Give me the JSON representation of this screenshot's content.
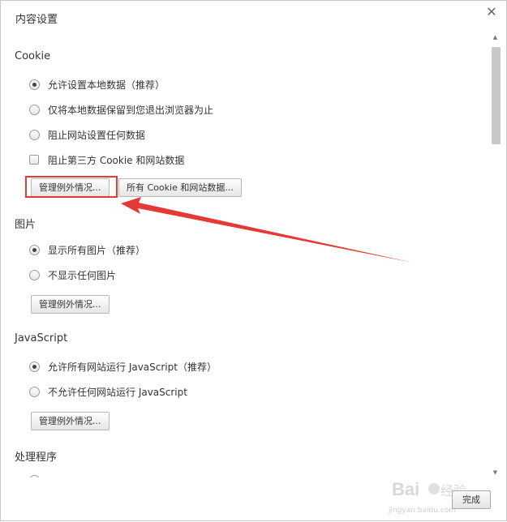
{
  "dialog": {
    "title": "内容设置",
    "done_label": "完成"
  },
  "cookie": {
    "section_title": "Cookie",
    "options": [
      "允许设置本地数据（推荐）",
      "仅将本地数据保留到您退出浏览器为止",
      "阻止网站设置任何数据"
    ],
    "selected_index": 0,
    "block_third_party_label": "阻止第三方 Cookie 和网站数据",
    "block_third_party_checked": false,
    "manage_exceptions_label": "管理例外情况...",
    "all_cookies_label": "所有 Cookie 和网站数据..."
  },
  "images": {
    "section_title": "图片",
    "options": [
      "显示所有图片（推荐）",
      "不显示任何图片"
    ],
    "selected_index": 0,
    "manage_exceptions_label": "管理例外情况..."
  },
  "javascript": {
    "section_title": "JavaScript",
    "options": [
      "允许所有网站运行 JavaScript（推荐）",
      "不允许任何网站运行 JavaScript"
    ],
    "selected_index": 0,
    "manage_exceptions_label": "管理例外情况..."
  },
  "handlers": {
    "section_title": "处理程序"
  },
  "annotation": {
    "color": "#e53935"
  },
  "watermark": {
    "text": "Baidu经验",
    "url_text": "jingyan.baidu.com"
  }
}
